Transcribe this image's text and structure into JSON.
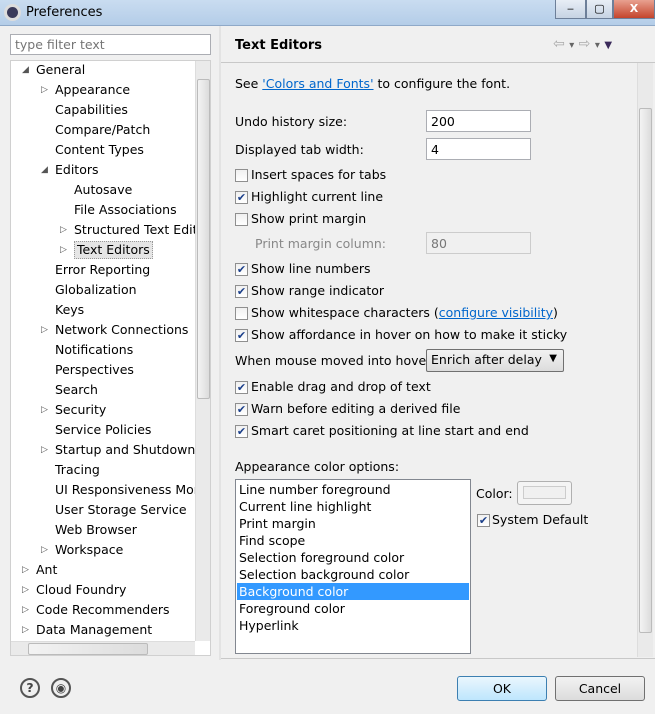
{
  "window": {
    "title": "Preferences",
    "minimize": "‒",
    "maximize": "▢",
    "close": "X"
  },
  "filter": {
    "placeholder": "type filter text"
  },
  "tree": [
    {
      "label": "General",
      "level": 0,
      "arrow": "expanded"
    },
    {
      "label": "Appearance",
      "level": 1,
      "arrow": "collapsed"
    },
    {
      "label": "Capabilities",
      "level": 1,
      "arrow": "none"
    },
    {
      "label": "Compare/Patch",
      "level": 1,
      "arrow": "none"
    },
    {
      "label": "Content Types",
      "level": 1,
      "arrow": "none"
    },
    {
      "label": "Editors",
      "level": 1,
      "arrow": "expanded"
    },
    {
      "label": "Autosave",
      "level": 2,
      "arrow": "none"
    },
    {
      "label": "File Associations",
      "level": 2,
      "arrow": "none"
    },
    {
      "label": "Structured Text Edito",
      "level": 2,
      "arrow": "collapsed"
    },
    {
      "label": "Text Editors",
      "level": 2,
      "arrow": "collapsed",
      "selected": true
    },
    {
      "label": "Error Reporting",
      "level": 1,
      "arrow": "none"
    },
    {
      "label": "Globalization",
      "level": 1,
      "arrow": "none"
    },
    {
      "label": "Keys",
      "level": 1,
      "arrow": "none"
    },
    {
      "label": "Network Connections",
      "level": 1,
      "arrow": "collapsed"
    },
    {
      "label": "Notifications",
      "level": 1,
      "arrow": "none"
    },
    {
      "label": "Perspectives",
      "level": 1,
      "arrow": "none"
    },
    {
      "label": "Search",
      "level": 1,
      "arrow": "none"
    },
    {
      "label": "Security",
      "level": 1,
      "arrow": "collapsed"
    },
    {
      "label": "Service Policies",
      "level": 1,
      "arrow": "none"
    },
    {
      "label": "Startup and Shutdown",
      "level": 1,
      "arrow": "collapsed"
    },
    {
      "label": "Tracing",
      "level": 1,
      "arrow": "none"
    },
    {
      "label": "UI Responsiveness Mon",
      "level": 1,
      "arrow": "none"
    },
    {
      "label": "User Storage Service",
      "level": 1,
      "arrow": "none"
    },
    {
      "label": "Web Browser",
      "level": 1,
      "arrow": "none"
    },
    {
      "label": "Workspace",
      "level": 1,
      "arrow": "collapsed"
    },
    {
      "label": "Ant",
      "level": 0,
      "arrow": "collapsed"
    },
    {
      "label": "Cloud Foundry",
      "level": 0,
      "arrow": "collapsed"
    },
    {
      "label": "Code Recommenders",
      "level": 0,
      "arrow": "collapsed"
    },
    {
      "label": "Data Management",
      "level": 0,
      "arrow": "collapsed"
    }
  ],
  "page": {
    "title": "Text Editors",
    "nav": {
      "back": "⇦",
      "forward": "⇨",
      "menu": "▼",
      "dropdown": "▾"
    },
    "intro_prefix": "See ",
    "intro_link": "'Colors and Fonts'",
    "intro_suffix": " to configure the font.",
    "undo_label": "Undo history size:",
    "undo_value": "200",
    "tab_label": "Displayed tab width:",
    "tab_value": "4",
    "checkboxes": [
      {
        "label": "Insert spaces for tabs",
        "checked": false
      },
      {
        "label": "Highlight current line",
        "checked": true
      },
      {
        "label": "Show print margin",
        "checked": false
      }
    ],
    "margin_label": "Print margin column:",
    "margin_value": "80",
    "checkboxes2": [
      {
        "label": "Show line numbers",
        "checked": true
      },
      {
        "label": "Show range indicator",
        "checked": true
      },
      {
        "label": "Show whitespace characters (",
        "checked": false,
        "link": "configure visibility",
        "after": ")"
      },
      {
        "label": "Show affordance in hover on how to make it sticky",
        "checked": true
      }
    ],
    "hover_label": "When mouse moved into hover:",
    "hover_value": "Enrich after delay",
    "checkboxes3": [
      {
        "label": "Enable drag and drop of text",
        "checked": true
      },
      {
        "label": "Warn before editing a derived file",
        "checked": true
      },
      {
        "label": "Smart caret positioning at line start and end",
        "checked": true
      }
    ],
    "color_options_label": "Appearance color options:",
    "color_options": [
      "Line number foreground",
      "Current line highlight",
      "Print margin",
      "Find scope",
      "Selection foreground color",
      "Selection background color",
      "Background color",
      "Foreground color",
      "Hyperlink"
    ],
    "color_selected": "Background color",
    "color_label": "Color:",
    "system_default_label": "System Default",
    "system_default_checked": true
  },
  "buttons": {
    "ok": "OK",
    "cancel": "Cancel",
    "help": "?",
    "import": "◉"
  },
  "check_mark": "✔"
}
